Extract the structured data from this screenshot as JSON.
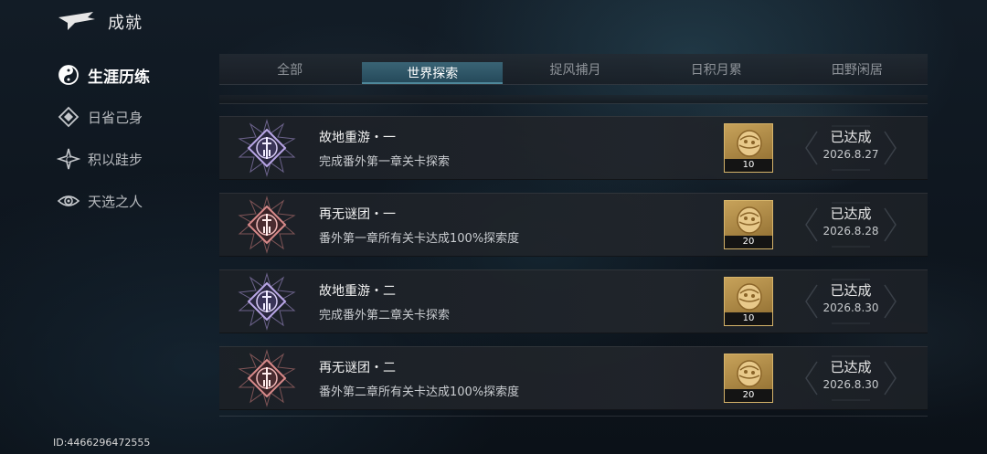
{
  "header": {
    "title": "成就"
  },
  "sidebar": {
    "items": [
      {
        "label": "生涯历练",
        "icon": "yin-yang-icon",
        "active": true
      },
      {
        "label": "日省己身",
        "icon": "diamond-layers-icon",
        "active": false
      },
      {
        "label": "积以跬步",
        "icon": "star-burst-icon",
        "active": false
      },
      {
        "label": "天选之人",
        "icon": "eye-icon",
        "active": false
      }
    ]
  },
  "tabs": [
    {
      "label": "全部",
      "active": false
    },
    {
      "label": "世界探索",
      "active": true
    },
    {
      "label": "捉风捕月",
      "active": false
    },
    {
      "label": "日积月累",
      "active": false
    },
    {
      "label": "田野闲居",
      "active": false
    }
  ],
  "achievements": [
    {
      "name": "故地重游・一",
      "desc": "完成番外第一章关卡探索",
      "badge": "purple-sword-badge-icon",
      "reward_count": "10",
      "status": "已达成",
      "date": "2026.8.27"
    },
    {
      "name": "再无谜团・一",
      "desc": "番外第一章所有关卡达成100%探索度",
      "badge": "red-sword-badge-icon",
      "reward_count": "20",
      "status": "已达成",
      "date": "2026.8.28"
    },
    {
      "name": "故地重游・二",
      "desc": "完成番外第二章关卡探索",
      "badge": "purple-sword-badge-icon",
      "reward_count": "10",
      "status": "已达成",
      "date": "2026.8.30"
    },
    {
      "name": "再无谜团・二",
      "desc": "番外第二章所有关卡达成100%探索度",
      "badge": "red-sword-badge-icon",
      "reward_count": "20",
      "status": "已达成",
      "date": "2026.8.30"
    }
  ],
  "footer": {
    "user_id": "ID:4466296472555"
  },
  "colors": {
    "purple_badge": "#b9a6e6",
    "red_badge": "#d88a8a",
    "reward_gold": "#c7a25a",
    "active_tab": "#3f8ba6"
  }
}
